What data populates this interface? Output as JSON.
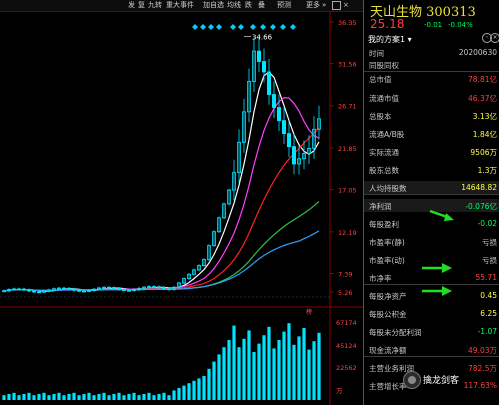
{
  "toolbar": {
    "items": [
      "发",
      "复",
      "九转",
      "重大事件",
      "加自选",
      "均线",
      "跌",
      "叠",
      "预测",
      "更多"
    ]
  },
  "chart": {
    "price_scale": [
      "36.35",
      "31.56",
      "26.71",
      "21.85",
      "17.05",
      "12.19",
      "7.39",
      "5.26"
    ],
    "high_label": "34.66",
    "volume_scale": [
      "67174",
      "45124",
      "22562",
      "万"
    ],
    "volume_marker": "榜",
    "colors": {
      "up": "#00e5ff",
      "down": "#ff3030",
      "ma5": "#ffffff",
      "ma10": "#ff40ff",
      "ma20": "#ff2020",
      "ma60": "#30c040",
      "ma120": "#30a0ff"
    }
  },
  "sidebar": {
    "title": "天山生物 300313",
    "price": "25.18",
    "change": "-0.01",
    "change_pct": "-0.04%",
    "plan": "我的方案1",
    "rows": [
      {
        "label": "时间",
        "value": "20200630"
      },
      {
        "label": "同股同权",
        "value": ""
      },
      {
        "label": "总市值",
        "value": "78.81亿"
      },
      {
        "label": "流通市值",
        "value": "46.37亿"
      },
      {
        "label": "总股本",
        "value": "3.13亿"
      },
      {
        "label": "流通A/B股",
        "value": "1.84亿"
      },
      {
        "label": "实际流通",
        "value": "9506万"
      },
      {
        "label": "股东总数",
        "value": "1.3万"
      },
      {
        "label": "人均持股数",
        "value": "14648.82"
      },
      {
        "label": "净利润",
        "value": "-0.076亿"
      },
      {
        "label": "每股盈利",
        "value": "-0.02"
      },
      {
        "label": "市盈率(静)",
        "value": "亏损"
      },
      {
        "label": "市盈率(动)",
        "value": "亏损"
      },
      {
        "label": "市净率",
        "value": "55.71"
      },
      {
        "label": "每股净资产",
        "value": "0.45"
      },
      {
        "label": "每股公积金",
        "value": "6.25"
      },
      {
        "label": "每股未分配利润",
        "value": "-1.07"
      },
      {
        "label": "现金流净额",
        "value": "49.03万"
      },
      {
        "label": "主营业务利润",
        "value": "782.5万"
      },
      {
        "label": "主营增长率",
        "value": "117.63%"
      }
    ],
    "watermark": "擒龙剑客"
  }
}
